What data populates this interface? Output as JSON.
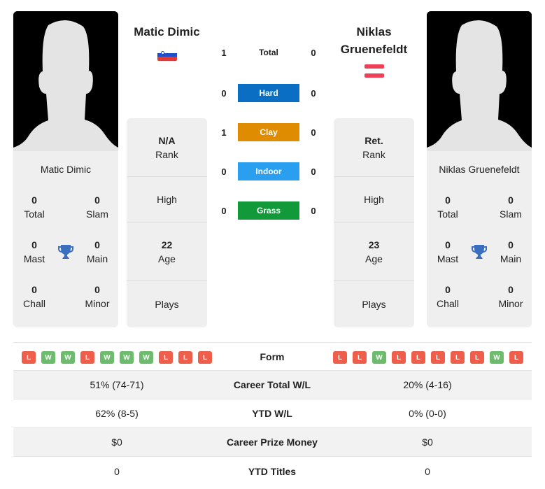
{
  "player1": {
    "name": "Matic Dimic",
    "card_name": "Matic Dimic",
    "flag": "slovenia-flag",
    "rank": {
      "value": "N/A",
      "label": "Rank"
    },
    "high": {
      "value": "",
      "label": "High"
    },
    "age": {
      "value": "22",
      "label": "Age"
    },
    "plays": {
      "value": "",
      "label": "Plays"
    },
    "titles": {
      "total": {
        "value": "0",
        "label": "Total"
      },
      "slam": {
        "value": "0",
        "label": "Slam"
      },
      "mast": {
        "value": "0",
        "label": "Mast"
      },
      "main": {
        "value": "0",
        "label": "Main"
      },
      "chall": {
        "value": "0",
        "label": "Chall"
      },
      "minor": {
        "value": "0",
        "label": "Minor"
      }
    },
    "form": [
      "L",
      "W",
      "W",
      "L",
      "W",
      "W",
      "W",
      "L",
      "L",
      "L"
    ]
  },
  "player2": {
    "name_line1": "Niklas",
    "name_line2": "Gruenefeldt",
    "card_name": "Niklas Gruenefeldt",
    "flag": "austria-flag",
    "rank": {
      "value": "Ret.",
      "label": "Rank"
    },
    "high": {
      "value": "",
      "label": "High"
    },
    "age": {
      "value": "23",
      "label": "Age"
    },
    "plays": {
      "value": "",
      "label": "Plays"
    },
    "titles": {
      "total": {
        "value": "0",
        "label": "Total"
      },
      "slam": {
        "value": "0",
        "label": "Slam"
      },
      "mast": {
        "value": "0",
        "label": "Mast"
      },
      "main": {
        "value": "0",
        "label": "Main"
      },
      "chall": {
        "value": "0",
        "label": "Chall"
      },
      "minor": {
        "value": "0",
        "label": "Minor"
      }
    },
    "form": [
      "L",
      "L",
      "W",
      "L",
      "L",
      "L",
      "L",
      "L",
      "W",
      "L"
    ]
  },
  "h2h": [
    {
      "label": "Total",
      "p1": "1",
      "p2": "0",
      "color": ""
    },
    {
      "label": "Hard",
      "p1": "0",
      "p2": "0",
      "color": "#0a6fc2"
    },
    {
      "label": "Clay",
      "p1": "1",
      "p2": "0",
      "color": "#e08c00"
    },
    {
      "label": "Indoor",
      "p1": "0",
      "p2": "0",
      "color": "#2b9fef"
    },
    {
      "label": "Grass",
      "p1": "0",
      "p2": "0",
      "color": "#129a3a"
    }
  ],
  "form_label": "Form",
  "stats": [
    {
      "label": "Career Total W/L",
      "p1": "51% (74-71)",
      "p2": "20% (4-16)"
    },
    {
      "label": "YTD W/L",
      "p1": "62% (8-5)",
      "p2": "0% (0-0)"
    },
    {
      "label": "Career Prize Money",
      "p1": "$0",
      "p2": "$0"
    },
    {
      "label": "YTD Titles",
      "p1": "0",
      "p2": "0"
    }
  ],
  "colors": {
    "trophy": "#3a6fbf",
    "win": "#6dbb6d",
    "loss": "#ee5e4a"
  }
}
